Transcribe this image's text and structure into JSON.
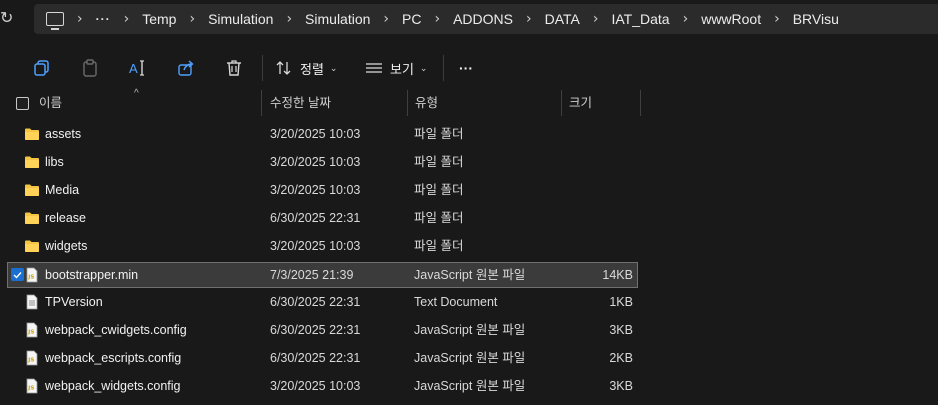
{
  "address": {
    "more": "···",
    "path": [
      "Temp",
      "Simulation",
      "Simulation",
      "PC",
      "ADDONS",
      "DATA",
      "IAT_Data",
      "wwwRoot",
      "BRVisu"
    ]
  },
  "toolbar": {
    "sort_label": "정렬",
    "view_label": "보기",
    "more_label": "···"
  },
  "columns": {
    "name": "이름",
    "date": "수정한 날짜",
    "type": "유형",
    "size": "크기"
  },
  "files": [
    {
      "name": "assets",
      "date": "3/20/2025 10:03",
      "type": "파일 폴더",
      "size": "",
      "icon": "folder-icon"
    },
    {
      "name": "libs",
      "date": "3/20/2025 10:03",
      "type": "파일 폴더",
      "size": "",
      "icon": "folder-icon"
    },
    {
      "name": "Media",
      "date": "3/20/2025 10:03",
      "type": "파일 폴더",
      "size": "",
      "icon": "folder-icon"
    },
    {
      "name": "release",
      "date": "6/30/2025 22:31",
      "type": "파일 폴더",
      "size": "",
      "icon": "folder-icon"
    },
    {
      "name": "widgets",
      "date": "3/20/2025 10:03",
      "type": "파일 폴더",
      "size": "",
      "icon": "folder-icon"
    },
    {
      "name": "bootstrapper.min",
      "date": "7/3/2025 21:39",
      "type": "JavaScript 원본 파일",
      "size": "14KB",
      "icon": "js-file-icon",
      "selected": true
    },
    {
      "name": "TPVersion",
      "date": "6/30/2025 22:31",
      "type": "Text Document",
      "size": "1KB",
      "icon": "text-file-icon"
    },
    {
      "name": "webpack_cwidgets.config",
      "date": "6/30/2025 22:31",
      "type": "JavaScript 원본 파일",
      "size": "3KB",
      "icon": "js-file-icon"
    },
    {
      "name": "webpack_escripts.config",
      "date": "6/30/2025 22:31",
      "type": "JavaScript 원본 파일",
      "size": "2KB",
      "icon": "js-file-icon"
    },
    {
      "name": "webpack_widgets.config",
      "date": "3/20/2025 10:03",
      "type": "JavaScript 원본 파일",
      "size": "3KB",
      "icon": "js-file-icon"
    }
  ],
  "colors": {
    "background": "#191919",
    "folder": "#f4c542",
    "selection_check": "#1a6fd1"
  }
}
